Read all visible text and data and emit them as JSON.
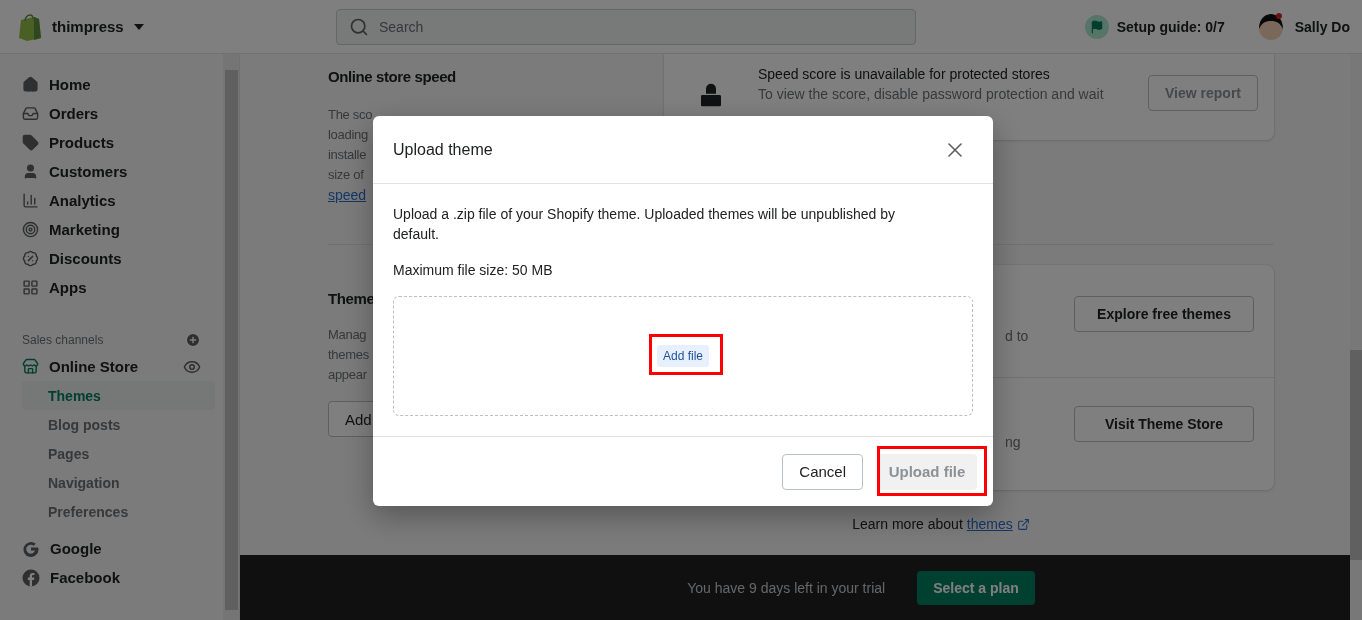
{
  "top_bar": {
    "store_name": "thimpress",
    "search": {
      "placeholder": "Search"
    },
    "setup_guide": "Setup guide: 0/7",
    "user_name": "Sally Do"
  },
  "sidebar": {
    "items": [
      {
        "label": "Home",
        "selected": false
      },
      {
        "label": "Orders",
        "selected": false
      },
      {
        "label": "Products",
        "selected": false
      },
      {
        "label": "Customers",
        "selected": false
      },
      {
        "label": "Analytics",
        "selected": false
      },
      {
        "label": "Marketing",
        "selected": false
      },
      {
        "label": "Discounts",
        "selected": false
      },
      {
        "label": "Apps",
        "selected": false
      }
    ],
    "channels_heading": "Sales channels",
    "channel": {
      "label": "Online Store",
      "selected": false
    },
    "subitems": [
      {
        "label": "Themes",
        "selected": true
      },
      {
        "label": "Blog posts",
        "selected": false
      },
      {
        "label": "Pages",
        "selected": false
      },
      {
        "label": "Navigation",
        "selected": false
      },
      {
        "label": "Preferences",
        "selected": false
      }
    ],
    "apps": [
      {
        "label": "Google",
        "selected": false
      },
      {
        "label": "Facebook",
        "selected": false
      }
    ]
  },
  "speed_section": {
    "title": "Online store speed",
    "description_lines": [
      "The sco",
      "loading",
      "installe",
      "size of"
    ],
    "link": "speed",
    "notice": {
      "title": "Speed score is unavailable for protected stores",
      "lines": [
        "To view the score, disable password protection and wait"
      ]
    },
    "button": "View report"
  },
  "themes_section": {
    "title": "Theme",
    "description_lines": [
      "Manag",
      "themes",
      "appear"
    ],
    "button": "Add",
    "rows": [
      {
        "text": "d to",
        "button": "Explore free themes"
      },
      {
        "text": "ng",
        "button": "Visit Theme Store"
      }
    ]
  },
  "learn_more": {
    "text": "Learn more about",
    "link": "themes"
  },
  "trial_bar": {
    "text": "You have 9 days left in your trial",
    "button": "Select a plan"
  },
  "modal": {
    "title": "Upload theme",
    "description": "Upload a .zip file of your Shopify theme. Uploaded themes will be unpublished by default.",
    "max_size": "Maximum file size: 50 MB",
    "add_file": {
      "label": "Add file",
      "highlighted": true
    },
    "buttons": [
      {
        "label": "Cancel",
        "kind": "secondary",
        "disabled": false,
        "highlighted": false
      },
      {
        "label": "Upload file",
        "kind": "primary",
        "disabled": true,
        "highlighted": true
      }
    ]
  }
}
